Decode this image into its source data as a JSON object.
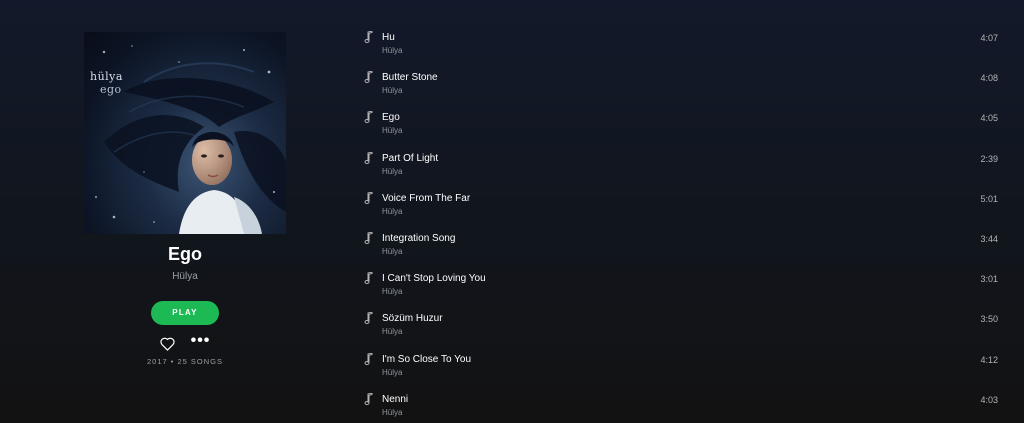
{
  "album": {
    "cover_artist_text": "hülya",
    "cover_title_text": "ego",
    "title": "Ego",
    "artist": "Hülya",
    "play_label": "PLAY",
    "meta": "2017 • 25 SONGS",
    "icons": {
      "save": "heart-icon",
      "more": "more-options-icon"
    }
  },
  "tracks": [
    {
      "name": "Hu",
      "artist": "Hülya",
      "duration": "4:07"
    },
    {
      "name": "Butter Stone",
      "artist": "Hülya",
      "duration": "4:08"
    },
    {
      "name": "Ego",
      "artist": "Hülya",
      "duration": "4:05"
    },
    {
      "name": "Part Of Light",
      "artist": "Hülya",
      "duration": "2:39"
    },
    {
      "name": "Voice From The Far",
      "artist": "Hülya",
      "duration": "5:01"
    },
    {
      "name": "Integration Song",
      "artist": "Hülya",
      "duration": "3:44"
    },
    {
      "name": "I Can't Stop Loving You",
      "artist": "Hülya",
      "duration": "3:01"
    },
    {
      "name": "Sözüm Huzur",
      "artist": "Hülya",
      "duration": "3:50"
    },
    {
      "name": "I'm So Close To You",
      "artist": "Hülya",
      "duration": "4:12"
    },
    {
      "name": "Nenni",
      "artist": "Hülya",
      "duration": "4:03"
    }
  ],
  "colors": {
    "accent": "#1db954",
    "text_secondary": "#9aa0a6"
  }
}
